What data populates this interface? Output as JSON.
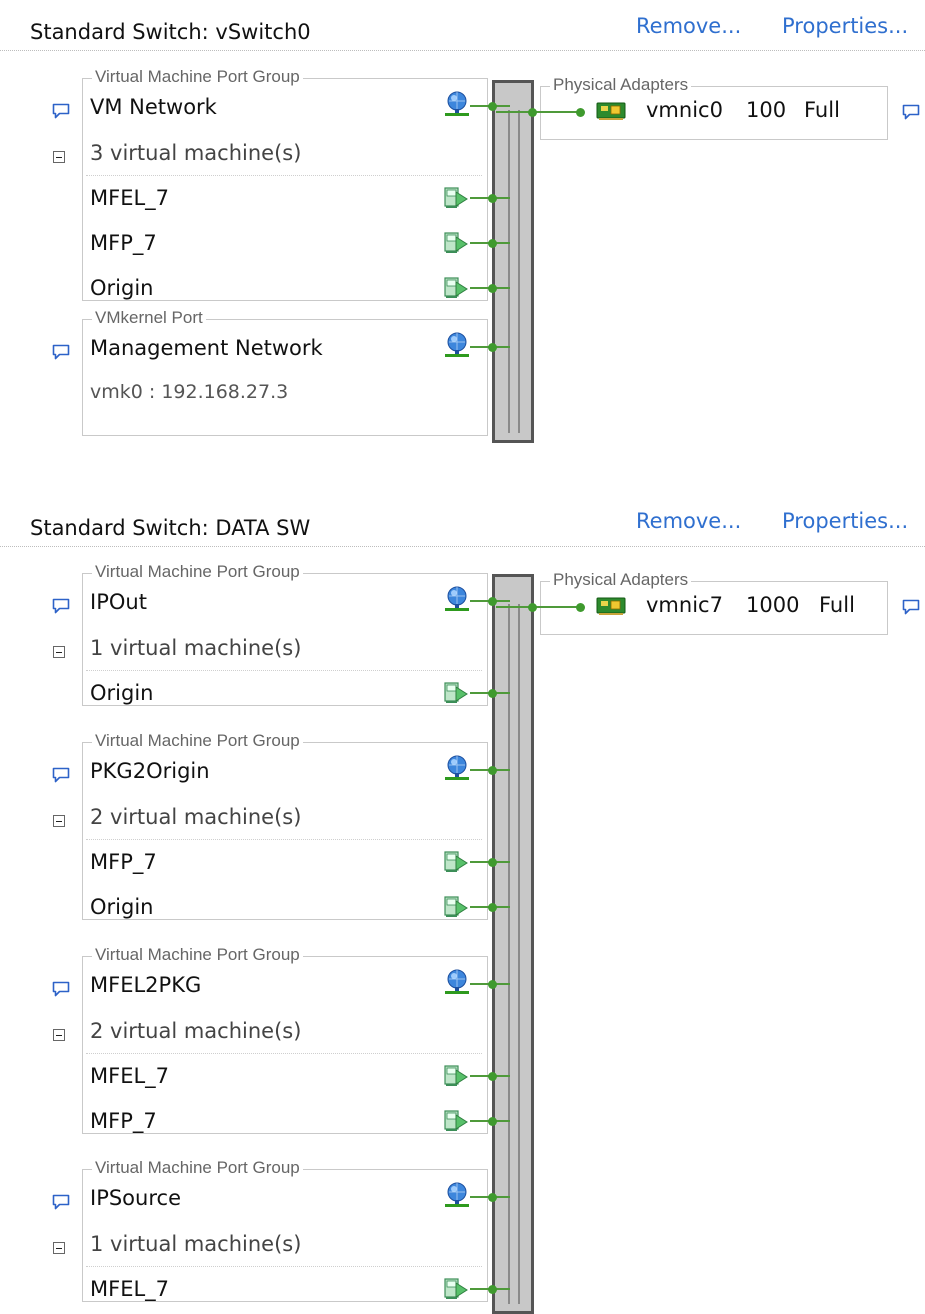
{
  "colors": {
    "link": "#2f6fcf",
    "wire": "#4f9a3a",
    "bus_fill": "#c8c8c8",
    "bus_border": "#555555"
  },
  "switches": [
    {
      "title": "Standard Switch: vSwitch0",
      "remove_label": "Remove...",
      "properties_label": "Properties...",
      "adapters_legend": "Physical Adapters",
      "adapter": {
        "name": "vmnic0",
        "speed": "100",
        "duplex": "Full"
      },
      "groups": [
        {
          "legend": "Virtual Machine Port Group",
          "name": "VM Network",
          "vm_count": "3 virtual machine(s)",
          "vms": [
            "MFEL_7",
            "MFP_7",
            "Origin"
          ]
        },
        {
          "legend": "VMkernel Port",
          "name": "Management Network",
          "ip": "vmk0 : 192.168.27.3"
        }
      ]
    },
    {
      "title": "Standard Switch: DATA SW",
      "remove_label": "Remove...",
      "properties_label": "Properties...",
      "adapters_legend": "Physical Adapters",
      "adapter": {
        "name": "vmnic7",
        "speed": "1000",
        "duplex": "Full"
      },
      "groups": [
        {
          "legend": "Virtual Machine Port Group",
          "name": "IPOut",
          "vm_count": "1 virtual machine(s)",
          "vms": [
            "Origin"
          ]
        },
        {
          "legend": "Virtual Machine Port Group",
          "name": "PKG2Origin",
          "vm_count": "2 virtual machine(s)",
          "vms": [
            "MFP_7",
            "Origin"
          ]
        },
        {
          "legend": "Virtual Machine Port Group",
          "name": "MFEL2PKG",
          "vm_count": "2 virtual machine(s)",
          "vms": [
            "MFEL_7",
            "MFP_7"
          ]
        },
        {
          "legend": "Virtual Machine Port Group",
          "name": "IPSource",
          "vm_count": "1 virtual machine(s)",
          "vms": [
            "MFEL_7"
          ]
        }
      ]
    }
  ],
  "icons": {
    "comment": "speech-bubble-icon",
    "network": "network-globe-icon",
    "vm": "virtual-machine-icon",
    "nic": "network-card-icon",
    "collapse": "collapse-minus-icon"
  }
}
